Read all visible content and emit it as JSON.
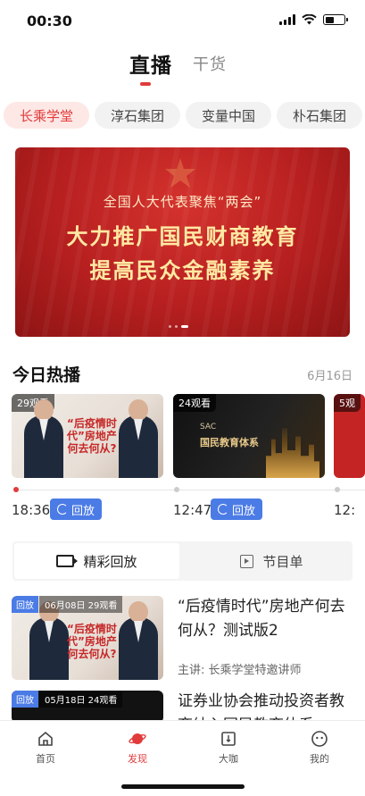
{
  "status_bar": {
    "time": "00:30"
  },
  "top_tabs": {
    "live": "直播",
    "goods": "干货"
  },
  "chips": [
    "长乘学堂",
    "淳石集团",
    "变量中国",
    "朴石集团"
  ],
  "banner": {
    "subtitle": "全国人大代表聚焦“两会”",
    "line1": "大力推广国民财商教育",
    "line2": "提高民众金融素养"
  },
  "hot": {
    "title": "今日热播",
    "date": "6月16日",
    "cards": [
      {
        "views": "29观看",
        "headline": "“后疫情时代”房地产何去何从?",
        "time": "18:36",
        "replay": "回放"
      },
      {
        "views": "24观看",
        "headline": "国民教育体系",
        "time": "12:47",
        "replay": "回放"
      },
      {
        "views": "5观",
        "time": "12:"
      }
    ]
  },
  "section_tabs": {
    "replay": "精彩回放",
    "schedule": "节目单"
  },
  "replays": [
    {
      "tag": "回放",
      "meta": "06月08日 29观看",
      "title": "“后疫情时代”房地产何去何从？测试版2",
      "speaker": "主讲: 长乘学堂特邀讲师"
    },
    {
      "tag": "回放",
      "meta": "05月18日 24观看",
      "title": "证券业协会推动投资者教育纳入国民教育体系"
    }
  ],
  "bottom_nav": [
    {
      "label": "首页",
      "icon": "home-icon"
    },
    {
      "label": "发现",
      "icon": "planet-icon"
    },
    {
      "label": "大咖",
      "icon": "book-icon"
    },
    {
      "label": "我的",
      "icon": "face-icon"
    }
  ],
  "colors": {
    "accent": "#e23b3b",
    "replay_blue": "#4b7be5"
  }
}
